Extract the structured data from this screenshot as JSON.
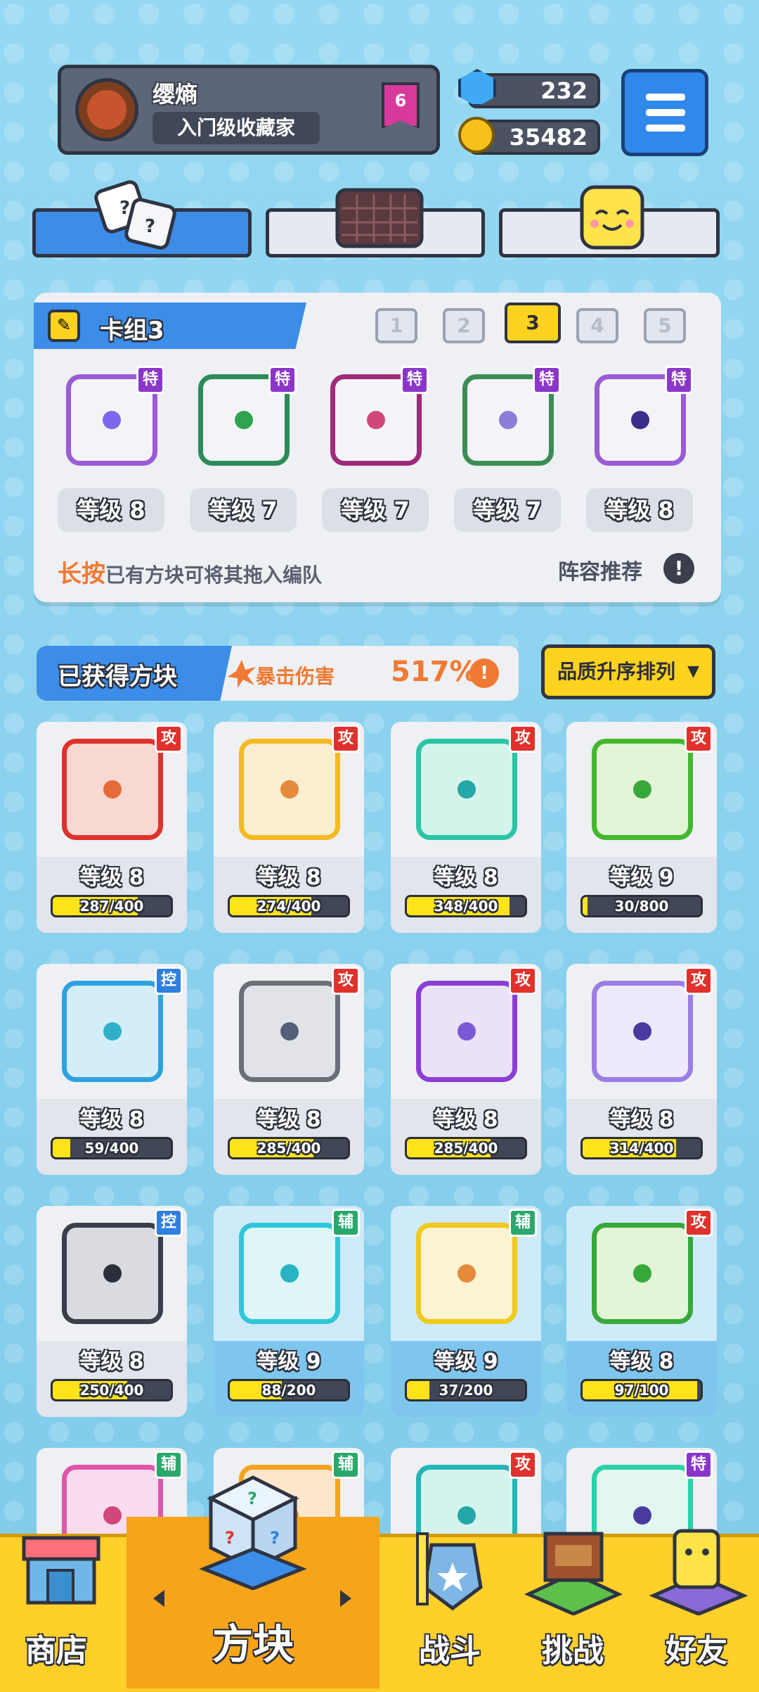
{
  "header": {
    "player_name": "缨熵",
    "player_title": "入门级收藏家",
    "rank_badge": "6",
    "gems": "232",
    "gold": "35482"
  },
  "tabs": [
    {
      "name": "dice",
      "active": true
    },
    {
      "name": "board",
      "active": false
    },
    {
      "name": "emoji",
      "active": false
    }
  ],
  "deck": {
    "title": "卡组3",
    "numbers": [
      "1",
      "2",
      "3",
      "4",
      "5"
    ],
    "selected": "3",
    "cards": [
      {
        "tag": "特",
        "level": "等级 8",
        "color": "#9a5bd6",
        "dot": "#7b68ee"
      },
      {
        "tag": "特",
        "level": "等级 7",
        "color": "#2e8b57",
        "dot": "#2ea44f"
      },
      {
        "tag": "特",
        "level": "等级 7",
        "color": "#a02a7a",
        "dot": "#d0487a"
      },
      {
        "tag": "特",
        "level": "等级 7",
        "color": "#3c8d55",
        "dot": "#8a7dd6"
      },
      {
        "tag": "特",
        "level": "等级 8",
        "color": "#9a5bd6",
        "dot": "#3a2e8a"
      }
    ],
    "hint_highlight": "长按",
    "hint_text": "已有方块可将其拖入编队",
    "lineup_label": "阵容推荐",
    "lineup_icon": "!"
  },
  "obtained": {
    "title": "已获得方块",
    "crit_label": "暴击伤害",
    "crit_value": "517%",
    "crit_icon": "!",
    "sort_label": "品质升序排列"
  },
  "grid": [
    {
      "tag": "攻",
      "level": "等级 8",
      "progress": "287/400",
      "fill": 0.72,
      "frame": "#e0312c",
      "dot": "#e56b3a",
      "bg": "#f7d8d2",
      "blue": false
    },
    {
      "tag": "攻",
      "level": "等级 8",
      "progress": "274/400",
      "fill": 0.69,
      "frame": "#f5b921",
      "dot": "#e48a3a",
      "bg": "#fbeed0",
      "blue": false
    },
    {
      "tag": "攻",
      "level": "等级 8",
      "progress": "348/400",
      "fill": 0.87,
      "frame": "#2bc4a4",
      "dot": "#23a7a8",
      "bg": "#d4f3ea",
      "blue": false
    },
    {
      "tag": "攻",
      "level": "等级 9",
      "progress": "30/800",
      "fill": 0.04,
      "frame": "#43b82e",
      "dot": "#37a83a",
      "bg": "#e4f4d6",
      "blue": false
    },
    {
      "tag": "控",
      "level": "等级 8",
      "progress": "59/400",
      "fill": 0.15,
      "frame": "#2ea2de",
      "dot": "#2fb0c8",
      "bg": "#d3eef9",
      "blue": false
    },
    {
      "tag": "攻",
      "level": "等级 8",
      "progress": "285/400",
      "fill": 0.71,
      "frame": "#6c6f78",
      "dot": "#54607a",
      "bg": "#e2e3e8",
      "blue": false
    },
    {
      "tag": "攻",
      "level": "等级 8",
      "progress": "285/400",
      "fill": 0.71,
      "frame": "#8a3ed6",
      "dot": "#7a5ad6",
      "bg": "#ece2f8",
      "blue": false
    },
    {
      "tag": "攻",
      "level": "等级 8",
      "progress": "314/400",
      "fill": 0.79,
      "frame": "#9a7ee6",
      "dot": "#4a3aa0",
      "bg": "#efeafb",
      "blue": false
    },
    {
      "tag": "控",
      "level": "等级 8",
      "progress": "250/400",
      "fill": 0.63,
      "frame": "#3a3f4b",
      "dot": "#2b2f3a",
      "bg": "#d9dbe0",
      "blue": false
    },
    {
      "tag": "辅",
      "level": "等级 9",
      "progress": "88/200",
      "fill": 0.44,
      "frame": "#2ec6d8",
      "dot": "#29b3c3",
      "bg": "#dff6f8",
      "blue": true
    },
    {
      "tag": "辅",
      "level": "等级 9",
      "progress": "37/200",
      "fill": 0.19,
      "frame": "#f0c91c",
      "dot": "#e48a3a",
      "bg": "#fbf3d2",
      "blue": true
    },
    {
      "tag": "攻",
      "level": "等级 8",
      "progress": "97/100",
      "fill": 0.97,
      "frame": "#37a83a",
      "dot": "#37a83a",
      "bg": "#e4f4d6",
      "blue": true
    },
    {
      "tag": "辅",
      "level": "",
      "progress": "",
      "fill": 0,
      "frame": "#e056a8",
      "dot": "#d0487a",
      "bg": "#f9dcef",
      "blue": false
    },
    {
      "tag": "辅",
      "level": "",
      "progress": "",
      "fill": 0,
      "frame": "#f5a321",
      "dot": "#e48a3a",
      "bg": "#fde7cc",
      "blue": false
    },
    {
      "tag": "攻",
      "level": "",
      "progress": "",
      "fill": 0,
      "frame": "#23b5b5",
      "dot": "#23a7a8",
      "bg": "#d4f3ef",
      "blue": false
    },
    {
      "tag": "特",
      "level": "",
      "progress": "",
      "fill": 0,
      "frame": "#2bd1a8",
      "dot": "#4a3aa0",
      "bg": "#e2f7f0",
      "blue": false
    }
  ],
  "nav": {
    "shop": "商店",
    "blocks": "方块",
    "battle": "战斗",
    "challenge": "挑战",
    "friends": "好友"
  },
  "colors": {
    "accent_blue": "#3c8de8",
    "gold": "#ffcf2a",
    "orange": "#f07a33"
  }
}
